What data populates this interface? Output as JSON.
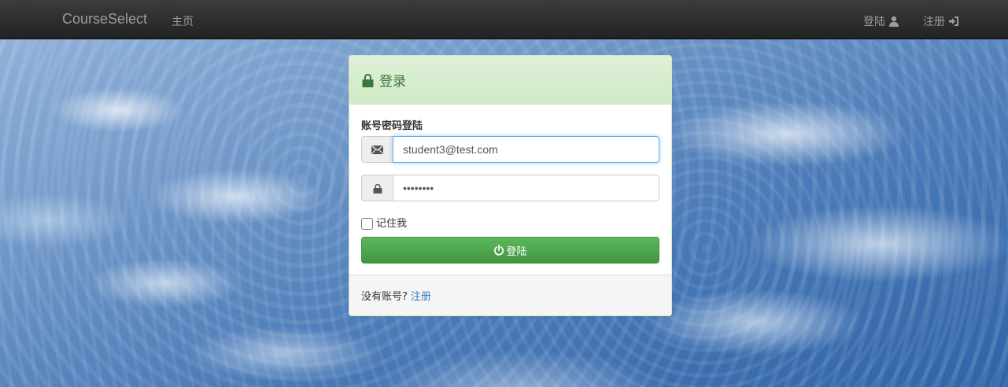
{
  "navbar": {
    "brand": "CourseSelect",
    "home": "主页",
    "login": "登陆",
    "register": "注册"
  },
  "panel": {
    "title": "登录",
    "section_label": "账号密码登陆",
    "email_value": "student3@test.com",
    "password_mask": "••••••••",
    "remember_label": "记住我",
    "submit_label": "登陆",
    "footer_prompt": "没有账号?",
    "footer_link": "注册"
  },
  "icons": {
    "lock": "lock-icon",
    "envelope": "envelope-icon",
    "user": "user-icon",
    "log-in": "log-in-icon",
    "power": "power-icon"
  },
  "colors": {
    "navbar": "#222222",
    "panel_heading": "#dff0d8",
    "heading_text": "#3c763d",
    "button": "#5cb85c",
    "link": "#337ab7"
  }
}
